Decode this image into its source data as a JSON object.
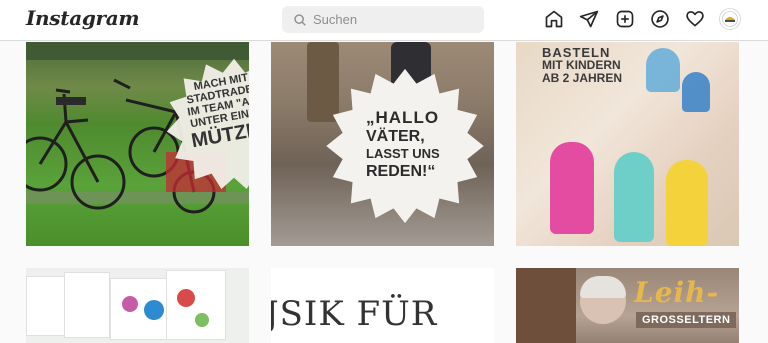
{
  "app": {
    "logo_text": "Instagram"
  },
  "search": {
    "placeholder": "Suchen",
    "value": ""
  },
  "nav_icons": [
    "home-icon",
    "direct-send-icon",
    "new-post-icon",
    "explore-compass-icon",
    "activity-heart-icon"
  ],
  "posts": [
    {
      "id": "p1",
      "lines": [
        "MACH MIT",
        "STADTRADEL",
        "IM TEAM \"ALL",
        "UNTER EINER"
      ],
      "highlight": "MÜTZE\""
    },
    {
      "id": "p2",
      "lines": [
        "„HALLO",
        "VÄTER,",
        "LASST UNS",
        "REDEN!“"
      ]
    },
    {
      "id": "p3",
      "lines": [
        "BASTELN",
        "MIT KINDERN",
        "AB 2 JAHREN"
      ]
    },
    {
      "id": "p4",
      "lines": []
    },
    {
      "id": "p5",
      "text": "JSIK FÜR"
    },
    {
      "id": "p6",
      "title": "Leih-",
      "subtitle": "GROSSELTERN"
    }
  ],
  "colors": {
    "topbar_bg": "#ffffff",
    "page_bg": "#fafafa",
    "search_bg": "#efefef",
    "icon_color": "#262626"
  }
}
